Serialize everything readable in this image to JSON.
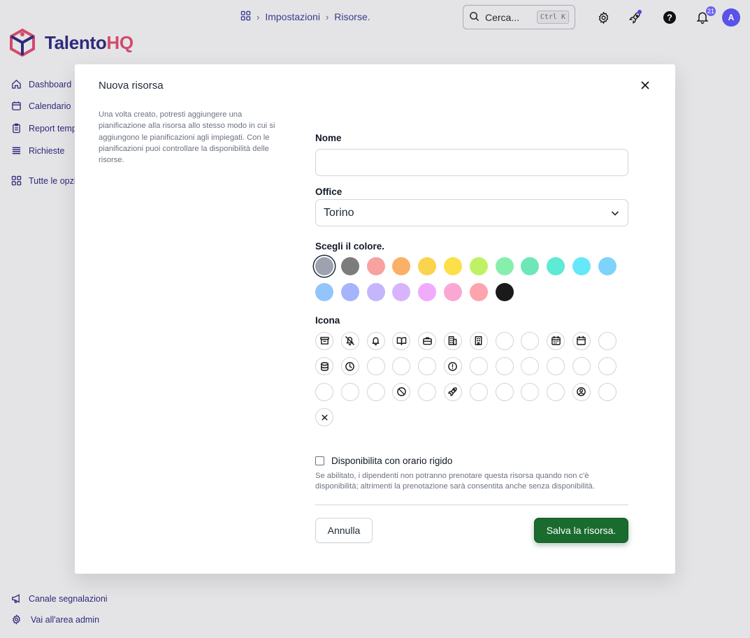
{
  "breadcrumb": {
    "items": [
      "Impostazioni",
      "Risorse."
    ]
  },
  "search": {
    "placeholder": "Cerca...",
    "shortcut": "Ctrl K"
  },
  "header": {
    "notification_count": "21",
    "avatar_initial": "A"
  },
  "brand": {
    "name_part1": "Talento",
    "name_part2": "HQ"
  },
  "sidebar": {
    "items": [
      {
        "label": "Dashboard",
        "icon": "home-icon"
      },
      {
        "label": "Calendario",
        "icon": "calendar-icon"
      },
      {
        "label": "Report temp",
        "icon": "clipboard-icon"
      },
      {
        "label": "Richieste",
        "icon": "list-icon"
      },
      {
        "label": "Tutte le opzi",
        "icon": "grid-icon"
      }
    ],
    "footer": [
      {
        "label": "Canale segnalazioni",
        "icon": "megaphone-icon"
      },
      {
        "label": "Vai all'area admin",
        "icon": "gear-icon"
      }
    ]
  },
  "modal": {
    "title": "Nuova risorsa",
    "description": "Una volta creato, potresti aggiungere una pianificazione alla risorsa allo stesso modo in cui si aggiungono le pianificazioni agli impiegati. Con le pianificazioni puoi controllare la disponibilità delle risorse.",
    "name_label": "Nome",
    "name_value": "",
    "office_label": "Office",
    "office_value": "Torino",
    "color_label": "Scegli il colore.",
    "colors": [
      "#9ca3af",
      "#7c7c7c",
      "#f8a1a1",
      "#fbb068",
      "#fcd34d",
      "#fde047",
      "#bef264",
      "#86efac",
      "#6ee7b7",
      "#5eead4",
      "#67e8f9",
      "#7dd3fc",
      "#93c5fd",
      "#a5b4fc",
      "#c4b5fd",
      "#d8b4fe",
      "#f0abfc",
      "#f9a8d4",
      "#fda4af",
      "#1a1a1a"
    ],
    "selected_color_index": 0,
    "icon_label": "Icona",
    "icons": [
      "archive-icon",
      "bell-off-icon",
      "bell-icon",
      "book-open-icon",
      "briefcase-icon",
      "building-icon",
      "office-building-icon",
      "blank-icon",
      "blank-icon",
      "calendar-days-icon",
      "calendar-icon",
      "blank-icon",
      "database-icon",
      "clock-icon",
      "blank-icon",
      "blank-icon",
      "blank-icon",
      "alert-circle-icon",
      "blank-icon",
      "blank-icon",
      "blank-icon",
      "blank-icon",
      "blank-icon",
      "blank-icon",
      "blank-icon",
      "blank-icon",
      "blank-icon",
      "ban-icon",
      "blank-icon",
      "rocket-icon",
      "blank-icon",
      "blank-icon",
      "blank-icon",
      "blank-icon",
      "user-circle-icon",
      "blank-icon",
      "x-icon"
    ],
    "strict_label": "Disponibilita con orario rigido",
    "strict_help": "Se abilitato, i dipendenti non potranno prenotare questa risorsa quando non c'è disponibilità; altrimenti la prenotazione sarà consentita anche senza disponibilità.",
    "cancel_label": "Annulla",
    "save_label": "Salva la risorsa."
  }
}
